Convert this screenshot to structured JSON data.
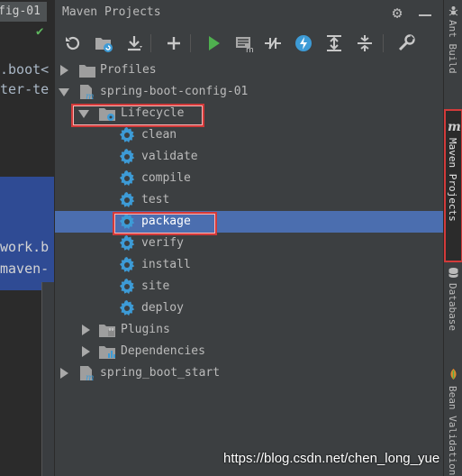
{
  "editor": {
    "tab_label": "fig-01",
    "code_lines": [
      ".boot<",
      "ter-te",
      "work.b",
      "maven-"
    ]
  },
  "panel": {
    "title": "Maven Projects"
  },
  "toolbar": {
    "buttons": [
      "refresh-icon",
      "generate-sources-icon",
      "download-icon",
      "add-icon",
      "run-icon",
      "execute-goal-icon",
      "toggle-offline-icon",
      "skip-tests-icon",
      "expand-all-icon",
      "collapse-all-icon",
      "settings-wrench-icon"
    ]
  },
  "tree": {
    "profiles": "Profiles",
    "project1": "spring-boot-config-01",
    "lifecycle": "Lifecycle",
    "phases": [
      "clean",
      "validate",
      "compile",
      "test",
      "package",
      "verify",
      "install",
      "site",
      "deploy"
    ],
    "plugins": "Plugins",
    "dependencies": "Dependencies",
    "project2": "spring_boot_start"
  },
  "right_bar": {
    "ant_build": "Ant Build",
    "maven_projects": "Maven Projects",
    "database": "Database",
    "bean_validation": "Bean Validation"
  },
  "colors": {
    "selection": "#4b6eaf",
    "highlight_box": "#d23a3a",
    "gear_blue": "#3d9bd6",
    "run_green": "#4fb04f"
  },
  "watermark": "https://blog.csdn.net/chen_long_yue"
}
